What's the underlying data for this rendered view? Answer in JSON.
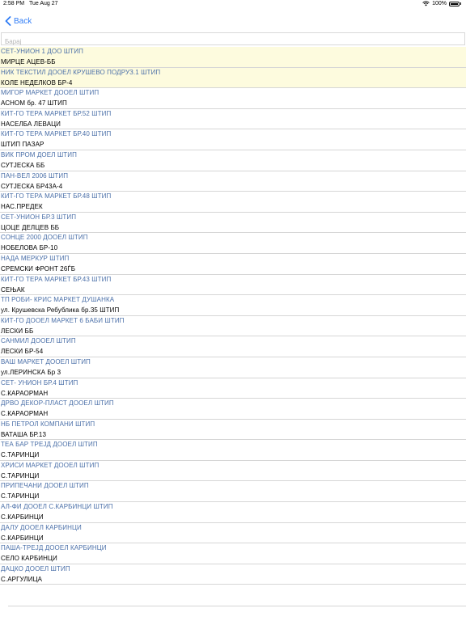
{
  "status_bar": {
    "time": "2:58 PM",
    "date": "Tue Aug 27",
    "battery": "100%",
    "wifi_icon": "wifi-icon",
    "battery_icon": "battery-icon"
  },
  "nav": {
    "back_label": "Back",
    "back_icon": "chevron-left-icon"
  },
  "search": {
    "placeholder": "Барај",
    "value": ""
  },
  "colors": {
    "accent": "#2f7cf6",
    "name_text": "#4a6fa8",
    "highlight": "#fdfbde"
  },
  "list": {
    "items": [
      {
        "name": "СЕТ-УНИОН 1  ДОО ШТИП",
        "address": "МИРЦЕ АЦЕВ-ББ",
        "highlighted": true
      },
      {
        "name": "НИК ТЕКСТИЛ ДООЕЛ КРУШЕВО ПОДРУЗ.1 ШТИП",
        "address": "КОЛЕ НЕДЕЛКОВ БР-4",
        "highlighted": true
      },
      {
        "name": "МИГОР МАРКЕТ ДООЕЛ ШТИП",
        "address": "АСНОМ бр. 47 ШТИП",
        "highlighted": false
      },
      {
        "name": "КИТ-ГО ТЕРА МАРКЕТ БР.52 ШТИП",
        "address": "НАСЕЛБА ЛЕВАЦИ",
        "highlighted": false
      },
      {
        "name": "КИТ-ГО ТЕРА МАРКЕТ БР.40 ШТИП",
        "address": "ШТИП ПАЗАР",
        "highlighted": false
      },
      {
        "name": "ВИК ПРОМ ДОЕЛ ШТИП",
        "address": "СУТЈЕСКА ББ",
        "highlighted": false
      },
      {
        "name": "ПАН-ВЕЛ 2006 ШТИП",
        "address": "СУТЈЕСКА БР43А-4",
        "highlighted": false
      },
      {
        "name": "КИТ-ГО ТЕРА МАРКЕТ БР.48 ШТИП",
        "address": "НАС.ПРЕДЕК",
        "highlighted": false
      },
      {
        "name": "СЕТ-УНИОН БР.3 ШТИП",
        "address": "ЦОЦЕ ДЕЛЦЕВ ББ",
        "highlighted": false
      },
      {
        "name": "СОНЦЕ 2000 ДООЕЛ ШТИП",
        "address": "НОБЕЛОВА БР-10",
        "highlighted": false
      },
      {
        "name": "НАДА МЕРКУР ШТИП",
        "address": "СРЕМСКИ ФРОНТ 26ЃБ",
        "highlighted": false
      },
      {
        "name": "КИТ-ГО ТЕРА МАРКЕТ БР.43 ШТИП",
        "address": "СЕЊАК",
        "highlighted": false
      },
      {
        "name": "ТП РОБИ- КРИС МАРКЕТ ДУШАНКА",
        "address": "ул. Крушевска Ребублика бр.35 ШТИП",
        "highlighted": false
      },
      {
        "name": "КИТ-ГО ДООЕЛ МАРКЕТ 6 БАБИ  ШТИП",
        "address": "ЛЕСКИ ББ",
        "highlighted": false
      },
      {
        "name": "САНМИЛ ДООЕЛ ШТИП",
        "address": "ЛЕСКИ БР-54",
        "highlighted": false
      },
      {
        "name": "ВАШ МАРКЕТ ДООЕЛ ШТИП",
        "address": "ул.ЛЕРИНСКА Бр 3",
        "highlighted": false
      },
      {
        "name": "СЕТ- УНИОН БР.4 ШТИП",
        "address": "С.КАРАОРМАН",
        "highlighted": false
      },
      {
        "name": "ДРВО ДЕКОР-ПЛАСТ ДООЕЛ ШТИП",
        "address": "С.КАРАОРМАН",
        "highlighted": false
      },
      {
        "name": "НБ ПЕТРОЛ КОМПАНИ ШТИП",
        "address": "ВАТАША БР.13",
        "highlighted": false
      },
      {
        "name": "ТЕА БАР ТРЕЈД ДООЕЛ ШТИП",
        "address": "С.ТАРИНЦИ",
        "highlighted": false
      },
      {
        "name": "ХРИСИ МАРКЕТ ДООЕЛ ШТИП",
        "address": "С.ТАРИНЦИ",
        "highlighted": false
      },
      {
        "name": "ПРИПЕЧАНИ ДООЕЛ ШТИП",
        "address": "С.ТАРИНЦИ",
        "highlighted": false
      },
      {
        "name": "АЛ-ФИ ДООЕЛ С.КАРБИНЦИ ШТИП",
        "address": "С.КАРБИНЦИ",
        "highlighted": false
      },
      {
        "name": "ДАЛУ ДООЕЛ КАРБИНЦИ",
        "address": "С.КАРБИНЦИ",
        "highlighted": false
      },
      {
        "name": "ПАША-ТРЕЈД  ДООЕЛ КАРБИНЦИ",
        "address": "СЕЛО КАРБИНЦИ",
        "highlighted": false
      },
      {
        "name": "ДАЦКО ДООЕЛ ШТИП",
        "address": "С.АРГУЛИЦА",
        "highlighted": false
      }
    ]
  }
}
